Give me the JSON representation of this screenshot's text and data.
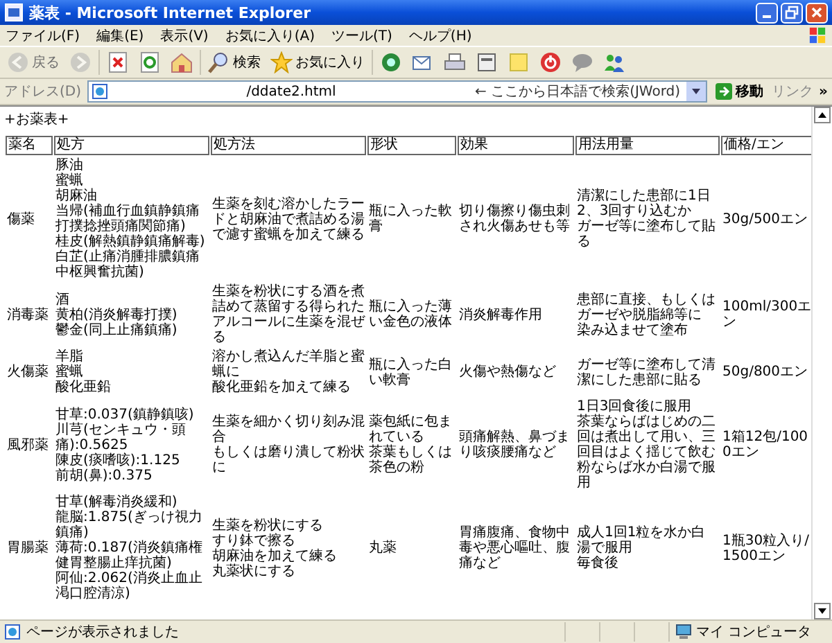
{
  "window": {
    "title": "薬表 - Microsoft Internet Explorer"
  },
  "menu": [
    "ファイル(F)",
    "編集(E)",
    "表示(V)",
    "お気に入り(A)",
    "ツール(T)",
    "ヘルプ(H)"
  ],
  "toolbar": [
    {
      "kind": "back",
      "label": "戻る",
      "disabled": true
    },
    {
      "kind": "forward",
      "disabled": true
    },
    {
      "kind": "stop",
      "disabled": false
    },
    {
      "kind": "refresh",
      "disabled": false
    },
    {
      "kind": "home",
      "disabled": false
    },
    {
      "kind": "search",
      "label": "検索",
      "disabled": false
    },
    {
      "kind": "favorites",
      "label": "お気に入り",
      "disabled": false
    },
    {
      "kind": "media",
      "disabled": false
    },
    {
      "kind": "mail",
      "disabled": false
    },
    {
      "kind": "print",
      "disabled": false
    },
    {
      "kind": "edit",
      "disabled": false
    },
    {
      "kind": "note",
      "disabled": false
    },
    {
      "kind": "power",
      "disabled": false
    },
    {
      "kind": "chat",
      "disabled": false
    },
    {
      "kind": "people",
      "disabled": false
    }
  ],
  "address": {
    "label": "アドレス(D)",
    "value": "/ddate2.html",
    "search_hint": "← ここから日本語で検索(JWord)",
    "go": "移動",
    "links": "リンク",
    "more": "»"
  },
  "page": {
    "heading": "+お薬表+",
    "table": {
      "columns": [
        "薬名",
        "処方",
        "処方法",
        "形状",
        "効果",
        "用法用量",
        "価格/エン"
      ],
      "rows": [
        [
          [
            "傷薬"
          ],
          [
            "豚油",
            "蜜蝋",
            "胡麻油",
            "当帰(補血行血鎮静鎮痛打撲捻挫頭痛関節痛)",
            "桂皮(解熱鎮静鎮痛解毒)",
            "白芷(止痛消腫排膿鎮痛中枢興奮抗菌)"
          ],
          [
            "生薬を刻む溶かしたラードと胡麻油で煮詰める湯で濾す蜜蝋を加えて練る"
          ],
          [
            "瓶に入った軟膏"
          ],
          [
            "切り傷擦り傷虫刺され火傷あせも等"
          ],
          [
            "清潔にした患部に1日2、3回すり込むか",
            "ガーゼ等に塗布して貼る"
          ],
          [
            "30g/500エン"
          ]
        ],
        [
          [
            "消毒薬"
          ],
          [
            "酒",
            "黄柏(消炎解毒打撲)",
            "鬱金(同上止痛鎮痛)"
          ],
          [
            "生薬を粉状にする酒を煮詰めて蒸留する得られたアルコールに生薬を混ぜる"
          ],
          [
            "瓶に入った薄い金色の液体"
          ],
          [
            "消炎解毒作用"
          ],
          [
            "患部に直接、もしくはガーゼや脱脂綿等に",
            "染み込ませて塗布"
          ],
          [
            "100ml/300エン"
          ]
        ],
        [
          [
            "火傷薬"
          ],
          [
            "羊脂",
            "蜜蝋",
            "酸化亜鉛"
          ],
          [
            "溶かし煮込んだ羊脂と蜜蝋に",
            "酸化亜鉛を加えて練る"
          ],
          [
            "瓶に入った白い軟膏"
          ],
          [
            "火傷や熱傷など"
          ],
          [
            "ガーゼ等に塗布して清潔にした患部に貼る"
          ],
          [
            "50g/800エン"
          ]
        ],
        [
          [
            "風邪薬"
          ],
          [
            "甘草:0.037(鎮静鎮咳)",
            "川芎(センキュウ・頭痛):0.5625",
            "陳皮(痰嗜咳):1.125",
            "前胡(鼻):0.375"
          ],
          [
            "生薬を細かく切り刻み混合",
            "もしくは磨り潰して粉状に"
          ],
          [
            "薬包紙に包まれている",
            "茶葉もしくは茶色の粉"
          ],
          [
            "頭痛解熱、鼻づまり咳痰腰痛など"
          ],
          [
            "1日3回食後に服用",
            "茶葉ならばはじめの二回は煮出して用い、三回目はよく揺じて飲む",
            "粉ならば水か白湯で服用"
          ],
          [
            "1箱12包/1000エン"
          ]
        ],
        [
          [
            "胃腸薬"
          ],
          [
            "甘草(解毒消炎緩和)",
            "龍脳:1.875(ぎっけ視力鎮痛)",
            "薄荷:0.187(消炎鎮痛権健胃整腸止痒抗菌)",
            "阿仙:2.062(消炎止血止渇口腔清涼)"
          ],
          [
            "生薬を粉状にする",
            "すり鉢で擦る",
            "胡麻油を加えて練る",
            "丸薬状にする"
          ],
          [
            "丸薬"
          ],
          [
            "胃痛腹痛、食物中毒や悪心嘔吐、腹痛など"
          ],
          [
            "成人1回1粒を水か白湯で服用",
            "毎食後"
          ],
          [
            "1瓶30粒入り/1500エン"
          ]
        ]
      ]
    }
  },
  "status": {
    "text": "ページが表示されました",
    "zone": "マイ コンピュータ"
  }
}
